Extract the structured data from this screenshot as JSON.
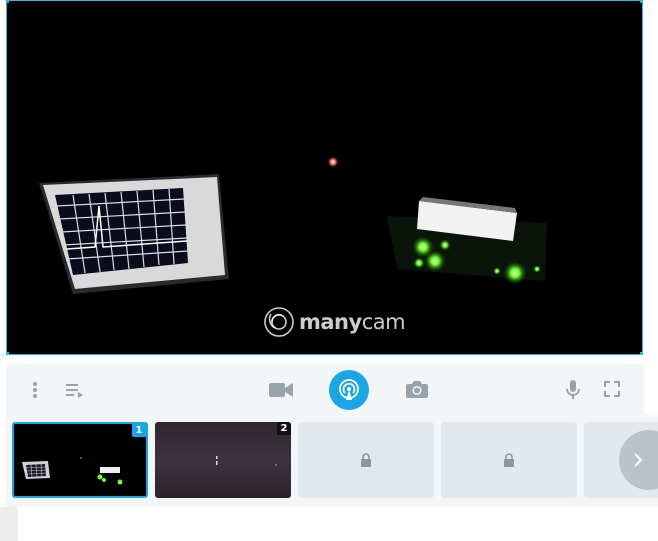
{
  "window": {
    "accent": "#1aa6e4",
    "border": "#29b6e6"
  },
  "preview": {
    "logo_bold": "many",
    "logo_rest": "cam",
    "logo_icon": "manycam-logo-icon"
  },
  "toolbar": {
    "left_icons": [
      "more-vertical-icon",
      "playlist-icon"
    ],
    "center_icons": [
      "video-camera-icon",
      "live-broadcast-icon",
      "camera-snapshot-icon"
    ],
    "right_icons": [
      "microphone-icon",
      "fullscreen-icon"
    ]
  },
  "sources": {
    "tiles": [
      {
        "badge": "1",
        "state": "active"
      },
      {
        "badge": "2",
        "state": "available"
      },
      {
        "badge": "",
        "state": "locked"
      },
      {
        "badge": "",
        "state": "locked"
      },
      {
        "badge": "",
        "state": "locked"
      }
    ],
    "next_icon": "chevron-right-icon"
  }
}
